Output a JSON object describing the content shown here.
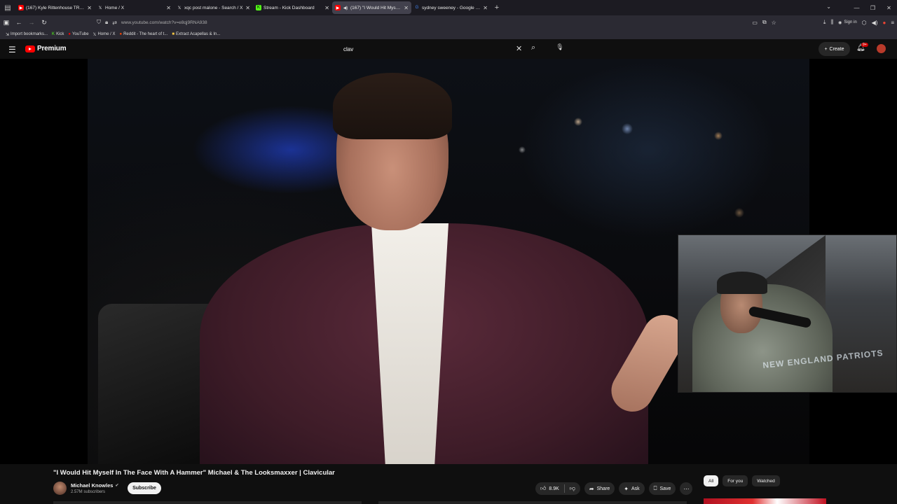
{
  "browser": {
    "tabs": [
      {
        "title": "(167) Kyle Rittenhouse TRASHE",
        "favicon_color": "#ff0000",
        "active": false
      },
      {
        "title": "Home / X",
        "favicon_color": "#ffffff",
        "active": false
      },
      {
        "title": "xqc post malone - Search / X",
        "favicon_color": "#ffffff",
        "active": false
      },
      {
        "title": "Stream - Kick Dashboard",
        "favicon_color": "#53fc18",
        "active": false
      },
      {
        "title": "(167) \"I Would Hit Myself I",
        "favicon_color": "#ff0000",
        "active": true
      },
      {
        "title": "sydney sweeney - Google Sear",
        "favicon_color": "#ffffff",
        "active": false
      }
    ],
    "url": "www.youtube.com/watch?v=e8qj9RNA938",
    "sign_in_label": "Sign in",
    "bookmarks": [
      {
        "label": "Import bookmarks...",
        "icon": "import-icon"
      },
      {
        "label": "Kick",
        "icon": "kick-icon"
      },
      {
        "label": "YouTube",
        "icon": "youtube-icon"
      },
      {
        "label": "Home / X",
        "icon": "x-icon"
      },
      {
        "label": "Reddit - The heart of t...",
        "icon": "reddit-icon"
      },
      {
        "label": "Extract Acapellas & In...",
        "icon": "folder-icon"
      }
    ]
  },
  "youtube": {
    "logo_text": "Premium",
    "search_query": "clav",
    "create_label": "Create",
    "notification_count": "9+",
    "video": {
      "title": "\"I Would Hit Myself In The Face With A Hammer\" Michael & The Looksmaxxer | Clavicular",
      "channel": "Michael Knowles",
      "subscribers": "2.57M subscribers",
      "subscribe_label": "Subscribe",
      "likes": "8.9K",
      "share_label": "Share",
      "ask_label": "Ask",
      "save_label": "Save",
      "webcam_shirt_text": "NEW ENGLAND PATRIOTS"
    },
    "chips": [
      "All",
      "For you",
      "Watched"
    ],
    "active_chip": "All"
  },
  "colors": {
    "brand_red": "#ff0000",
    "background": "#0f0f0f",
    "surface": "#272727"
  }
}
